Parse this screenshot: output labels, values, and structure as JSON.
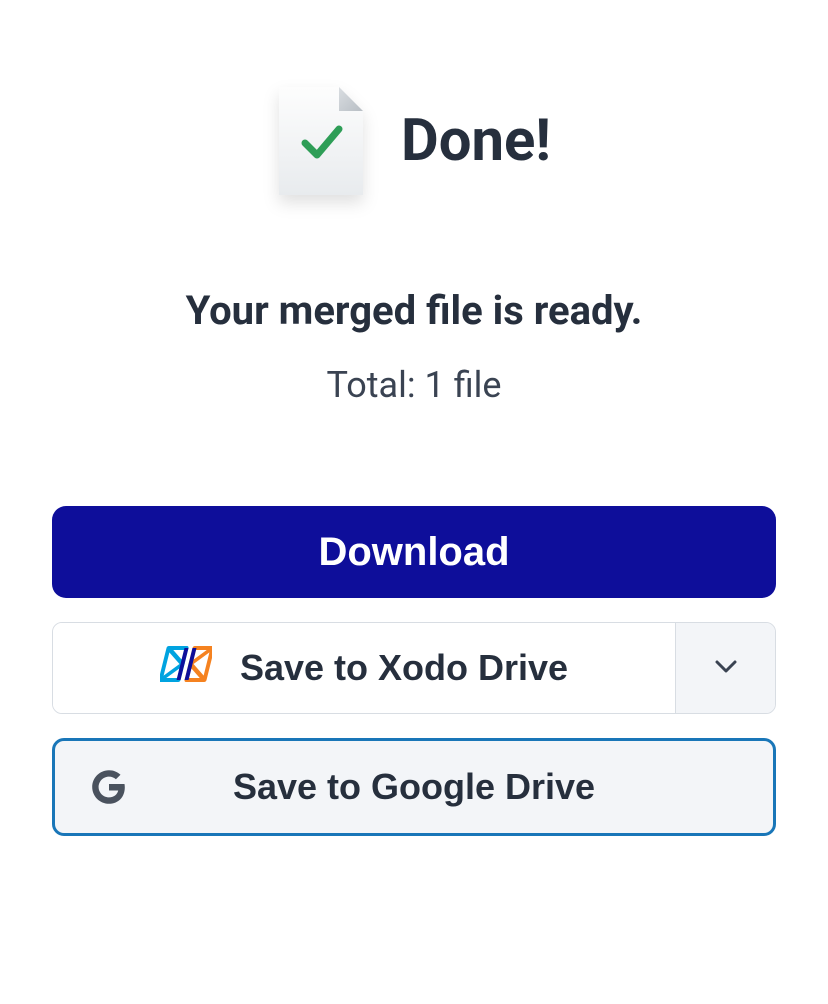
{
  "header": {
    "title": "Done!"
  },
  "status": {
    "ready_message": "Your merged file is ready.",
    "total_text": "Total: 1 file"
  },
  "actions": {
    "download_label": "Download",
    "xodo_label": "Save to Xodo Drive",
    "google_label": "Save to Google Drive"
  }
}
